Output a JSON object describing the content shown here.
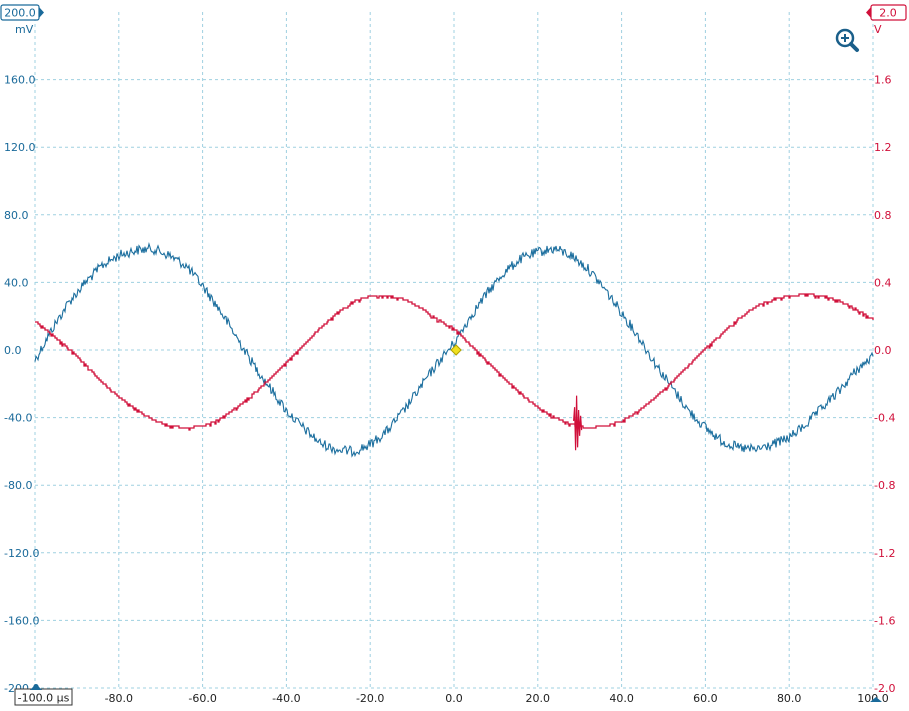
{
  "colors": {
    "channel_a": "#1b6e9e",
    "channel_b": "#d0103a",
    "grid": "#9fd0e0",
    "trigger": "#f0e020"
  },
  "icons": {
    "zoom": "zoom-in-icon"
  },
  "chart_data": {
    "type": "line",
    "x_unit": "µs",
    "xlim": [
      -100,
      100
    ],
    "x_ticks": [
      -80,
      -60,
      -40,
      -20,
      0,
      20,
      40,
      60,
      80,
      100
    ],
    "x_tick_labels": [
      "-80.0",
      "-60.0",
      "-40.0",
      "-20.0",
      "0.0",
      "20.0",
      "40.0",
      "60.0",
      "80.0",
      "100.0"
    ],
    "x_start_label": "-100.0 µs",
    "grid": true,
    "left_axis": {
      "unit": "mV",
      "range_label": "200.0",
      "ylim": [
        -200,
        200
      ],
      "ticks": [
        160,
        120,
        80,
        40,
        0,
        -40,
        -80,
        -120,
        -160,
        -200
      ],
      "tick_labels": [
        "160.0",
        "120.0",
        "80.0",
        "40.0",
        "0.0",
        "-40.0",
        "-80.0",
        "-120.0",
        "-160.0",
        "-200.0"
      ]
    },
    "right_axis": {
      "unit": "V",
      "range_label": "2.0",
      "ylim": [
        -2,
        2
      ],
      "ticks": [
        1.6,
        1.2,
        0.8,
        0.4,
        0,
        -0.4,
        -0.8,
        -1.2,
        -1.6,
        -2.0
      ],
      "tick_labels": [
        "1.6",
        "1.2",
        "0.8",
        "0.4",
        "0.0",
        "-0.4",
        "-0.8",
        "-1.2",
        "-1.6",
        "-2.0"
      ]
    },
    "series": [
      {
        "axis": "left",
        "x": [
          -100,
          -96,
          -92,
          -88,
          -84,
          -80,
          -76,
          -72,
          -68,
          -64,
          -60,
          -56,
          -52,
          -48,
          -44,
          -40,
          -36,
          -32,
          -28,
          -24,
          -20,
          -16,
          -12,
          -8,
          -4,
          0,
          4,
          8,
          12,
          16,
          20,
          24,
          28,
          32,
          36,
          40,
          44,
          48,
          52,
          56,
          60,
          64,
          68,
          72,
          76,
          80,
          84,
          88,
          92,
          96,
          100
        ],
        "y": [
          -6,
          12,
          28,
          40,
          50,
          56,
          59,
          60,
          56,
          50,
          38,
          24,
          8,
          -8,
          -22,
          -36,
          -46,
          -55,
          -59,
          -60,
          -56,
          -48,
          -36,
          -22,
          -8,
          4,
          20,
          34,
          46,
          54,
          58,
          60,
          56,
          48,
          36,
          22,
          8,
          -8,
          -22,
          -36,
          -46,
          -54,
          -58,
          -59,
          -56,
          -52,
          -44,
          -34,
          -24,
          -12,
          -4
        ]
      },
      {
        "axis": "right",
        "x": [
          -100,
          -96,
          -92,
          -88,
          -84,
          -80,
          -76,
          -72,
          -68,
          -64,
          -60,
          -56,
          -52,
          -48,
          -44,
          -40,
          -36,
          -32,
          -28,
          -24,
          -20,
          -16,
          -12,
          -8,
          -4,
          0,
          4,
          8,
          12,
          16,
          20,
          24,
          28,
          32,
          36,
          40,
          44,
          48,
          52,
          56,
          60,
          64,
          68,
          72,
          76,
          80,
          84,
          88,
          92,
          96,
          100
        ],
        "y": [
          0.17,
          0.09,
          0.01,
          -0.09,
          -0.19,
          -0.28,
          -0.35,
          -0.41,
          -0.45,
          -0.46,
          -0.45,
          -0.41,
          -0.34,
          -0.26,
          -0.17,
          -0.07,
          0.03,
          0.13,
          0.22,
          0.29,
          0.32,
          0.32,
          0.3,
          0.25,
          0.18,
          0.13,
          0.03,
          -0.07,
          -0.17,
          -0.26,
          -0.34,
          -0.4,
          -0.44,
          -0.46,
          -0.45,
          -0.42,
          -0.36,
          -0.28,
          -0.19,
          -0.09,
          0.01,
          0.1,
          0.19,
          0.26,
          0.3,
          0.32,
          0.33,
          0.32,
          0.29,
          0.24,
          0.18
        ]
      }
    ],
    "glitch": {
      "series": 1,
      "x": 29.5,
      "y_min": -0.61,
      "y_max": -0.27
    },
    "trigger_marker": {
      "x": 0.5,
      "y_left": 0
    }
  }
}
